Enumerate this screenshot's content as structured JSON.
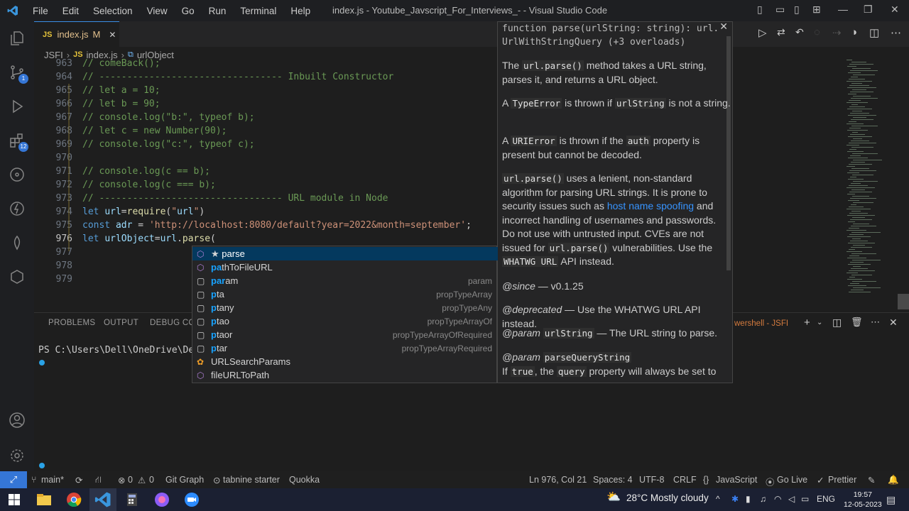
{
  "titlebar": {
    "menu": [
      "File",
      "Edit",
      "Selection",
      "View",
      "Go",
      "Run",
      "Terminal",
      "Help"
    ],
    "title": "index.js - Youtube_Javscript_For_Interviews_- - Visual Studio Code"
  },
  "activity_badges": {
    "scm": "1",
    "extensions": "12"
  },
  "tab": {
    "icon": "JS",
    "name": "index.js",
    "status": "M"
  },
  "breadcrumbs": {
    "folder": "JSFI",
    "file": "index.js",
    "symbol": "urlObject"
  },
  "code_lines": [
    {
      "n": "963",
      "text": "// comeBack();"
    },
    {
      "n": "964",
      "text": "// --------------------------------- Inbuilt Constructor"
    },
    {
      "n": "965",
      "text": "// let a = 10;"
    },
    {
      "n": "966",
      "text": "// let b = 90;"
    },
    {
      "n": "967",
      "text": "// console.log(\"b:\", typeof b);"
    },
    {
      "n": "968",
      "text": "// let c = new Number(90);"
    },
    {
      "n": "969",
      "text": "// console.log(\"c:\", typeof c);"
    },
    {
      "n": "970",
      "text": ""
    },
    {
      "n": "971",
      "text": "// console.log(c == b);"
    },
    {
      "n": "972",
      "text": "// console.log(c === b);"
    },
    {
      "n": "973",
      "text": "// --------------------------------- URL module in Node"
    },
    {
      "n": "974",
      "text": "let url=require(\"url\")"
    },
    {
      "n": "975",
      "text": "const adr = 'http://localhost:8080/default?year=2022&month=september';"
    },
    {
      "n": "976",
      "text": "let urlObject=url.parse("
    },
    {
      "n": "977",
      "text": ""
    },
    {
      "n": "978",
      "text": ""
    },
    {
      "n": "979",
      "text": ""
    }
  ],
  "hover": {
    "signature_1": "function parse(urlString: string): url.",
    "signature_2": "UrlWithStringQuery (+3 overloads)",
    "p1_a": "The ",
    "p1_code": "url.parse()",
    "p1_b": " method takes a URL string, parses it, and returns a URL object.",
    "p2_a": "A ",
    "p2_code1": "TypeError",
    "p2_b": " is thrown if ",
    "p2_code2": "urlString",
    "p2_c": " is not a string.",
    "p3_a": "A ",
    "p3_code1": "URIError",
    "p3_b": " is thrown if the ",
    "p3_code2": "auth",
    "p3_c": " property is present but cannot be decoded.",
    "p4_code": "url.parse()",
    "p4_a": " uses a lenient, non-standard algorithm for parsing URL strings. It is prone to security issues such as ",
    "p4_link": "host name spoofing",
    "p4_b": " and incorrect handling of usernames and passwords. Do not use with untrusted input. CVEs are not issued for ",
    "p4_code2": "url.parse()",
    "p4_c": " vulnerabilities. Use the ",
    "p4_code3": "WHATWG URL",
    "p4_d": " API instead.",
    "since": "@since",
    "since_val": " — v0.1.25",
    "deprecated": "@deprecated",
    "deprecated_val": " — Use the WHATWG URL API instead.",
    "param1": "@param",
    "param1_code": "urlString",
    "param1_val": " — The URL string to parse.",
    "param2": "@param",
    "param2_code": "parseQueryString",
    "param2_a": "If ",
    "param2_code2": "true",
    "param2_b": ", the ",
    "param2_code3": "query",
    "param2_c": " property will always be set to"
  },
  "suggestions": [
    {
      "pre": "★ ",
      "hl": "",
      "label": "parse",
      "detail": "",
      "type": "method"
    },
    {
      "pre": "",
      "hl": "pa",
      "label": "thToFileURL",
      "detail": "",
      "type": "method"
    },
    {
      "pre": "",
      "hl": "par",
      "label": "am",
      "detail": "param",
      "type": "text"
    },
    {
      "pre": "",
      "hl": "p",
      "label": "ta",
      "detail": "propTypeArray",
      "type": "text"
    },
    {
      "pre": "",
      "hl": "p",
      "label": "tany",
      "detail": "propTypeAny",
      "type": "text"
    },
    {
      "pre": "",
      "hl": "p",
      "label": "tao",
      "detail": "propTypeArrayOf",
      "type": "text"
    },
    {
      "pre": "",
      "hl": "p",
      "label": "taor",
      "detail": "propTypeArrayOfRequired",
      "type": "text"
    },
    {
      "pre": "",
      "hl": "p",
      "label": "tar",
      "detail": "propTypeArrayRequired",
      "type": "text"
    },
    {
      "pre": "",
      "hl": "",
      "label": "URLSearchParams",
      "detail": "",
      "type": "class"
    },
    {
      "pre": "",
      "hl": "",
      "label": "fileURLToPath",
      "detail": "",
      "type": "method"
    }
  ],
  "panel": {
    "tabs": [
      "PROBLEMS",
      "OUTPUT",
      "DEBUG CON"
    ],
    "terminal_name": "wershell - JSFI",
    "prompt": "PS C:\\Users\\Dell\\OneDrive\\De"
  },
  "status": {
    "branch": "main*",
    "errors": "0",
    "warnings": "0",
    "git_graph": "Git Graph",
    "tabnine": "tabnine starter",
    "quokka": "Quokka",
    "position": "Ln 976, Col 21",
    "spaces": "Spaces: 4",
    "encoding": "UTF-8",
    "eol": "CRLF",
    "language": "JavaScript",
    "golive": "Go Live",
    "prettier": "Prettier"
  },
  "taskbar": {
    "weather": "28°C  Mostly cloudy",
    "lang": "ENG",
    "time": "19:57",
    "date": "12-05-2023"
  }
}
